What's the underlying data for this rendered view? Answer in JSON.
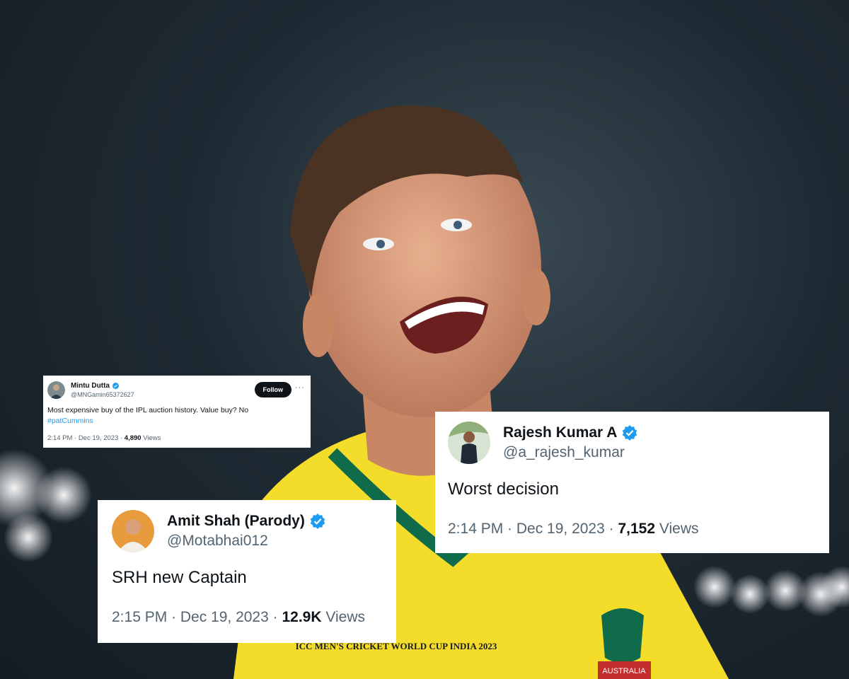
{
  "photo": {
    "description_icon": "cricketer-photo",
    "jersey_text": "ICC MEN'S CRICKET WORLD CUP INDIA 2023",
    "badge_text": "AUSTRALIA"
  },
  "tweets": [
    {
      "name": "Mintu Dutta",
      "handle": "@MNGamin65372627",
      "follow_label": "Follow",
      "more_icon": "···",
      "body_text": "Most expensive buy of the IPL auction history. Value buy? No",
      "hashtag": "#patCummins",
      "time": "2:14 PM · Dec 19, 2023 · ",
      "views_count": "4,890",
      "views_label": " Views"
    },
    {
      "name": "Amit Shah (Parody)",
      "handle": "@Motabhai012",
      "body_text": "SRH new Captain",
      "time": "2:15 PM · Dec 19, 2023 · ",
      "views_count": "12.9K",
      "views_label": " Views"
    },
    {
      "name": "Rajesh Kumar A",
      "handle": "@a_rajesh_kumar",
      "body_text": "Worst decision",
      "time": "2:14 PM · Dec 19, 2023 · ",
      "views_count": "7,152",
      "views_label": " Views"
    }
  ],
  "colors": {
    "verified": "#1d9bf0",
    "jersey_yellow": "#f4dc2a",
    "jersey_green": "#0f6b4a",
    "background": "#1e2a33"
  }
}
